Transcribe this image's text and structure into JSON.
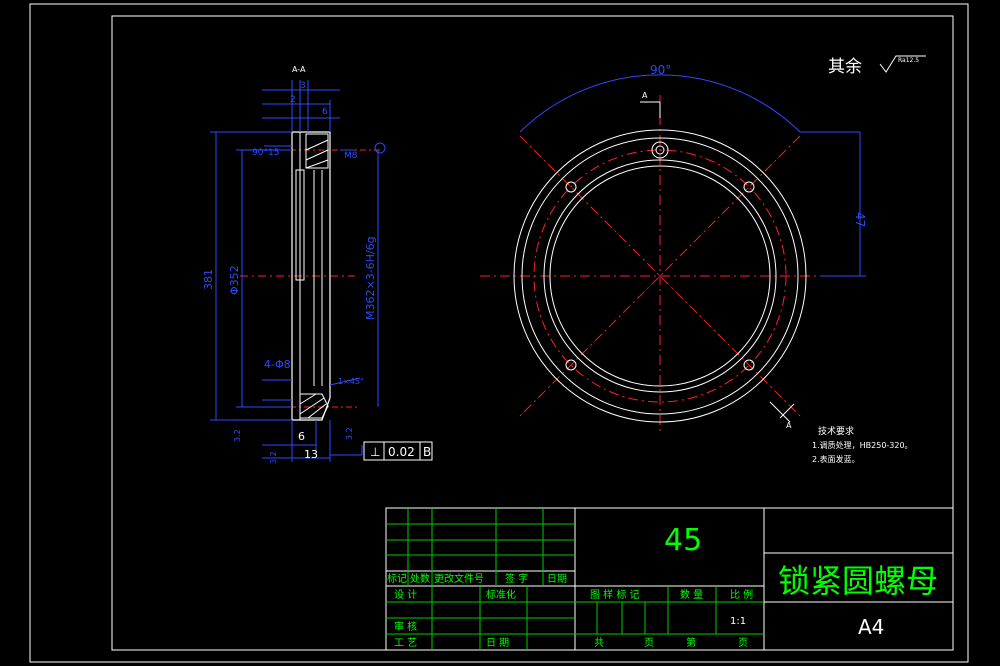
{
  "roughness": {
    "label": "其余",
    "value": "Ra12.5"
  },
  "section_view": {
    "title": "A-A",
    "angle_90": "90°",
    "hole_spec": "4-Φ8"
  },
  "dims_section": {
    "d_top_a": "3",
    "d_top_b": "2",
    "d_top_c": "6",
    "d_m8": "M8",
    "d_15": "15",
    "d_381": "381",
    "d_352": "Φ352",
    "thread": "M362×3-6H/6g",
    "d_6": "6",
    "d_13": "13",
    "chamfer": "1×45°",
    "ra_left": "3.2",
    "ra_bottom": "3.2",
    "ra_right": "3.2"
  },
  "tolerance": {
    "symbol": "⊥",
    "value": "0.02",
    "datum": "B"
  },
  "plan_view": {
    "angle": "90°",
    "dim_47": "47",
    "cut_label": "A"
  },
  "tech_requirements": {
    "title": "技术要求",
    "items": [
      "1.调质处理，HB250-320。",
      "2.表面发蓝。"
    ]
  },
  "title_block": {
    "material": "45",
    "part_name": "锁紧圆螺母",
    "sheet": "A4",
    "rev_headers": [
      "标记",
      "处数",
      "更改文件号",
      "签 字",
      "日期"
    ],
    "design": "设 计",
    "standardize": "标准化",
    "review": "审 核",
    "process": "工 艺",
    "date": "日 期",
    "pattern_mark": "图 样 标 记",
    "quantity": "数 量",
    "scale_label": "比 例",
    "scale_value": "1:1",
    "total": "共",
    "page": "页",
    "no": "第",
    "page2": "页"
  }
}
